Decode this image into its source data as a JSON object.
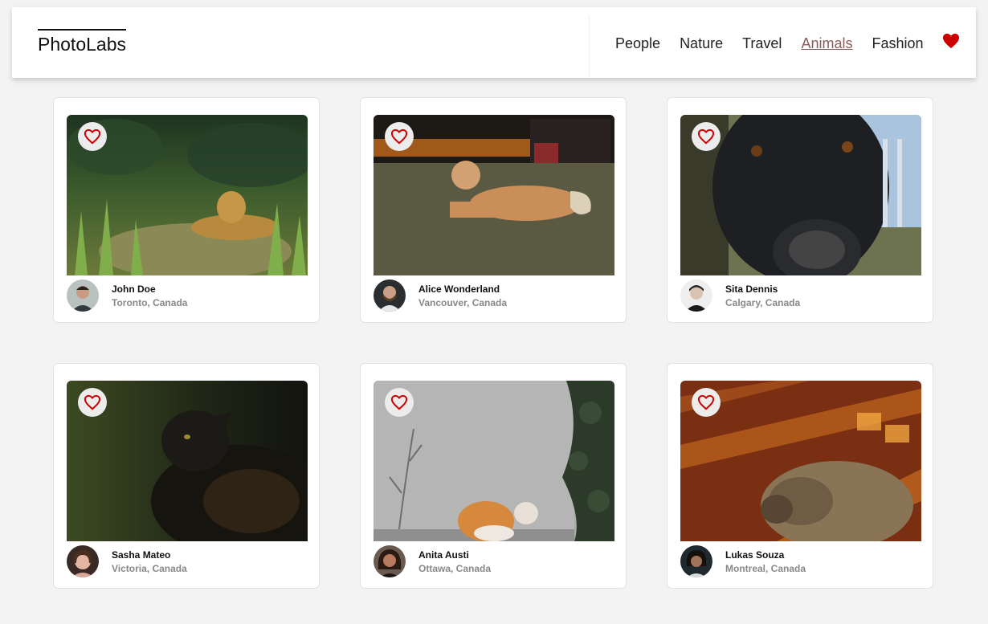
{
  "header": {
    "logo": "PhotoLabs",
    "nav": [
      "People",
      "Nature",
      "Travel",
      "Animals",
      "Fashion"
    ],
    "active_topic": "Animals",
    "favorites_icon": "heart-filled-icon",
    "accent_color": "#cc0000"
  },
  "photos": [
    {
      "subject": "leopard",
      "user": "John Doe",
      "location": "Toronto, Canada",
      "like_icon": "heart-outline-icon"
    },
    {
      "subject": "dog-lying",
      "user": "Alice Wonderland",
      "location": "Vancouver, Canada",
      "like_icon": "heart-outline-icon"
    },
    {
      "subject": "black-dog",
      "user": "Sita Dennis",
      "location": "Calgary, Canada",
      "like_icon": "heart-outline-icon"
    },
    {
      "subject": "black-cat",
      "user": "Sasha Mateo",
      "location": "Victoria, Canada",
      "like_icon": "heart-outline-icon"
    },
    {
      "subject": "orange-cat",
      "user": "Anita Austi",
      "location": "Ottawa, Canada",
      "like_icon": "heart-outline-icon"
    },
    {
      "subject": "tabby-cat",
      "user": "Lukas Souza",
      "location": "Montreal, Canada",
      "like_icon": "heart-outline-icon"
    }
  ]
}
